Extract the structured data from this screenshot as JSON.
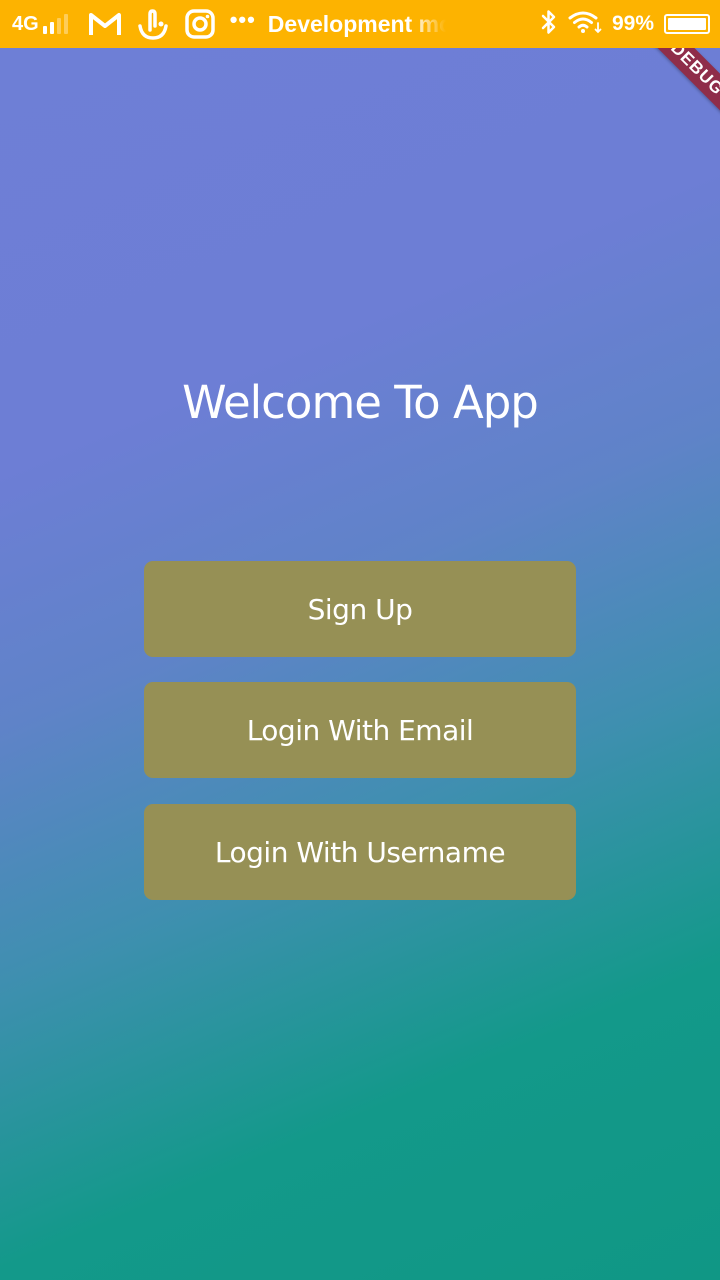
{
  "status_bar": {
    "network_type": "4G",
    "notification_text": "Development mode",
    "battery_percent": "99%",
    "more_indicator": "•••",
    "icons": [
      "gmail-icon",
      "touchpal-icon",
      "instagram-icon",
      "bluetooth-icon",
      "wifi-icon",
      "battery-icon"
    ]
  },
  "debug_banner": {
    "label": "DEBUG"
  },
  "main": {
    "title": "Welcome To App",
    "buttons": {
      "sign_up": "Sign Up",
      "login_email": "Login With Email",
      "login_username": "Login With Username"
    }
  },
  "colors": {
    "status_bar": "#fdb300",
    "gradient_top": "#6e7fd6",
    "gradient_bottom": "#109785",
    "button": "#969055",
    "debug_ribbon": "#8f2d4a"
  }
}
